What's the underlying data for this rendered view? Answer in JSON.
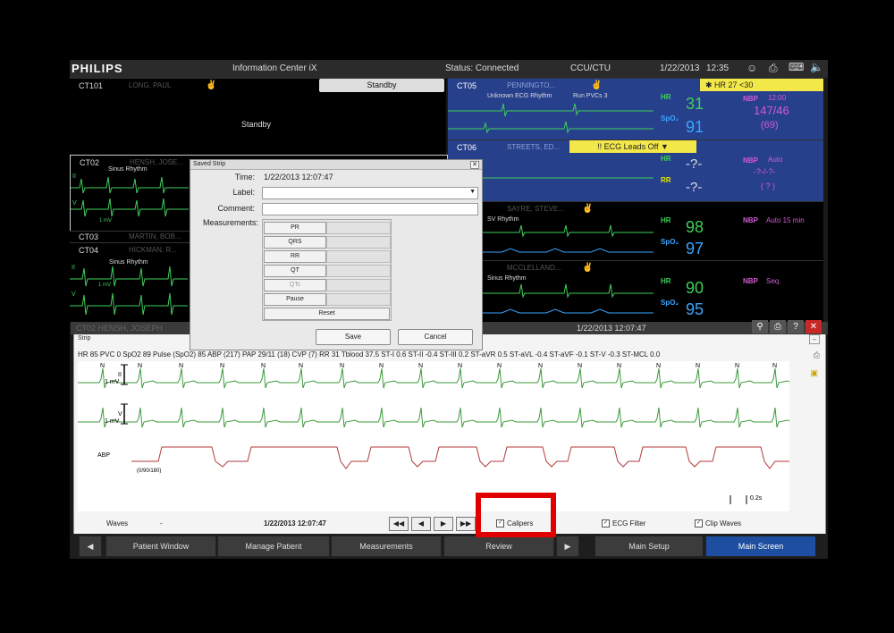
{
  "topbar": {
    "logo": "PHILIPS",
    "title": "Information Center iX",
    "status": "Status: Connected",
    "unit": "CCU/CTU",
    "date": "1/22/2013",
    "time": "12:35"
  },
  "alarm": {
    "text": "✱ HR  27  <30"
  },
  "beds": {
    "ct101": {
      "id": "CT101",
      "name": "LONG, PAUL",
      "standby_button": "Standby",
      "standby_text": "Standby"
    },
    "ct02": {
      "id": "CT02",
      "name": "HENSH, JOSE...",
      "rhythm": "Sinus Rhythm",
      "ii": "II",
      "v": "V",
      "mv": "1 mV"
    },
    "ct03": {
      "id": "CT03",
      "name": "MARTIN, BOB..."
    },
    "ct04": {
      "id": "CT04",
      "name": "HICKMAN, R...",
      "rhythm": "Sinus Rhythm",
      "ii": "II",
      "v": "V",
      "mv": "1 mV"
    },
    "ct05": {
      "id": "CT05",
      "name": "PENNINGTO...",
      "rhythm": "Unknown ECG Rhythm",
      "alert": "Run PVCs 3",
      "hr_label": "HR",
      "hr": "31",
      "spo2_label": "SpO₂",
      "spo2": "91",
      "nbp_label": "NBP",
      "nbp_time": "12:00",
      "nbp": "147/46",
      "nbp_mean": "(69)"
    },
    "ct06": {
      "id": "CT06",
      "name": "STREETS, ED...",
      "alert": "!! ECG Leads Off",
      "hr_label": "HR",
      "hr": "-?-",
      "rr_label": "RR",
      "rr": "-?-",
      "nbp_label": "NBP",
      "nbp_mode": "Auto",
      "nbp": "-?-/-?-",
      "nbp_mean": "( ? )"
    },
    "ct07": {
      "name": "SAYRE, STEVE...",
      "rhythm": "SV Rhythm",
      "hr_label": "HR",
      "hr": "98",
      "spo2_label": "SpO₂",
      "spo2": "97",
      "nbp_label": "NBP",
      "nbp_mode": "Auto 15 min"
    },
    "ct08": {
      "name": "MCCLELLAND...",
      "rhythm": "Sinus Rhythm",
      "hr_label": "HR",
      "hr": "90",
      "spo2_label": "SpO₂",
      "spo2": "95",
      "nbp_label": "NBP",
      "nbp_mode": "Seq."
    }
  },
  "dialog": {
    "title": "Saved Strip",
    "time_label": "Time:",
    "time_value": "1/22/2013 12:07:47",
    "label_label": "Label:",
    "comment_label": "Comment:",
    "measurements_label": "Measurements:",
    "buttons": [
      "PR",
      "QRS",
      "RR",
      "QT",
      "QTc",
      "Pause"
    ],
    "reset": "Reset",
    "save": "Save",
    "cancel": "Cancel"
  },
  "strip": {
    "patient": "CT02 HENSH, JOSEPH",
    "datetime": "1/22/2013 12:07:47",
    "title": "Strip",
    "measurements": "HR 85  PVC 0  SpO2 89  Pulse (SpO2) 85  ABP (217)  PAP 29/11 (18)  CVP (7)  RR 31  Tblood 37.5  ST-I 0.6  ST-II -0.4  ST-III 0.2  ST-aVR 0.5  ST-aVL -0.4  ST-aVF -0.1  ST-V -0.3  ST-MCL 0.0",
    "lead_ii": "II",
    "lead_v": "V",
    "mv": "1 mV",
    "abp": "ABP",
    "abp_scale": "(0/90/180)",
    "beat": "N",
    "scale": "0.2s",
    "waves_label": "Waves",
    "waves_value": "-",
    "timestamp": "1/22/2013 12:07:47",
    "calipers": "Calipers",
    "ecg_filter": "ECG Filter",
    "clip_waves": "Clip Waves"
  },
  "navbar": {
    "patient_window": "Patient Window",
    "manage_patient": "Manage Patient",
    "measurements": "Measurements",
    "review": "Review",
    "main_setup": "Main Setup",
    "main_screen": "Main Screen"
  }
}
